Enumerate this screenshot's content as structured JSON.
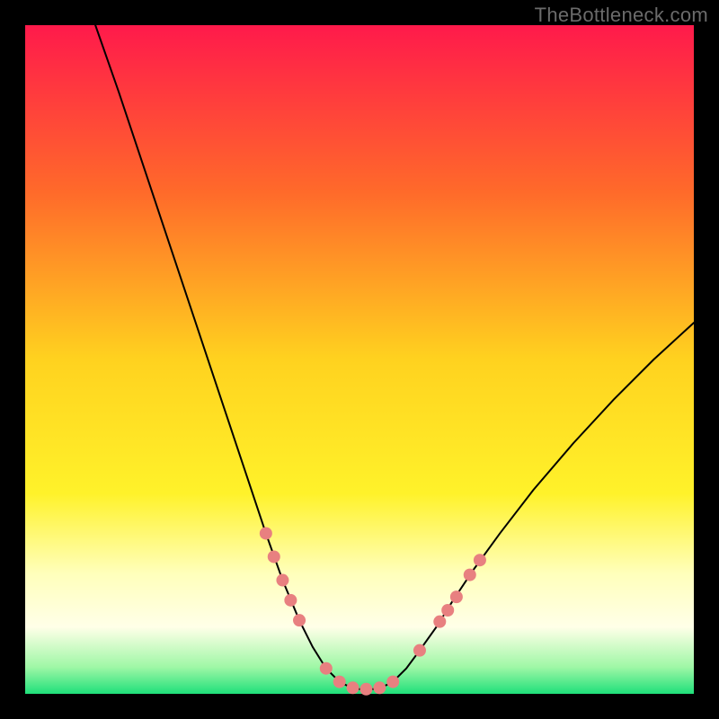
{
  "watermark": "TheBottleneck.com",
  "layout": {
    "outer_w": 800,
    "outer_h": 800,
    "inner_left": 28,
    "inner_top": 28,
    "inner_w": 744,
    "inner_h": 744
  },
  "chart_data": {
    "type": "line",
    "title": "",
    "xlabel": "",
    "ylabel": "",
    "xlim": [
      0,
      100
    ],
    "ylim": [
      0,
      100
    ],
    "grid": false,
    "background_gradient": {
      "stops": [
        {
          "t": 0.0,
          "color": "#ff1a4b"
        },
        {
          "t": 0.25,
          "color": "#ff6a2a"
        },
        {
          "t": 0.5,
          "color": "#ffd21f"
        },
        {
          "t": 0.7,
          "color": "#fff22a"
        },
        {
          "t": 0.82,
          "color": "#ffffbb"
        },
        {
          "t": 0.9,
          "color": "#ffffe8"
        },
        {
          "t": 0.96,
          "color": "#9ff7a6"
        },
        {
          "t": 1.0,
          "color": "#1fe07a"
        }
      ]
    },
    "series": [
      {
        "name": "bottleneck-curve",
        "color": "#000000",
        "width": 2,
        "points_xy": [
          [
            10.5,
            100.0
          ],
          [
            14.0,
            90.0
          ],
          [
            18.0,
            78.0
          ],
          [
            22.0,
            66.0
          ],
          [
            26.0,
            54.0
          ],
          [
            30.0,
            42.0
          ],
          [
            33.0,
            33.0
          ],
          [
            36.0,
            24.0
          ],
          [
            38.5,
            17.0
          ],
          [
            41.0,
            11.0
          ],
          [
            43.0,
            7.0
          ],
          [
            45.0,
            3.8
          ],
          [
            47.0,
            1.8
          ],
          [
            49.0,
            0.8
          ],
          [
            51.0,
            0.6
          ],
          [
            53.0,
            0.8
          ],
          [
            55.0,
            1.8
          ],
          [
            57.0,
            3.8
          ],
          [
            59.0,
            6.5
          ],
          [
            61.5,
            10.0
          ],
          [
            64.0,
            14.0
          ],
          [
            67.0,
            18.5
          ],
          [
            71.0,
            24.0
          ],
          [
            76.0,
            30.5
          ],
          [
            82.0,
            37.5
          ],
          [
            88.0,
            44.0
          ],
          [
            94.0,
            50.0
          ],
          [
            100.0,
            55.5
          ]
        ]
      }
    ],
    "markers": {
      "name": "highlight-dots",
      "color": "#e88080",
      "radius": 7,
      "points_xy": [
        [
          36.0,
          24.0
        ],
        [
          37.2,
          20.5
        ],
        [
          38.5,
          17.0
        ],
        [
          39.7,
          14.0
        ],
        [
          41.0,
          11.0
        ],
        [
          45.0,
          3.8
        ],
        [
          47.0,
          1.8
        ],
        [
          49.0,
          0.9
        ],
        [
          51.0,
          0.7
        ],
        [
          53.0,
          0.9
        ],
        [
          55.0,
          1.8
        ],
        [
          59.0,
          6.5
        ],
        [
          62.0,
          10.8
        ],
        [
          63.2,
          12.5
        ],
        [
          64.5,
          14.5
        ],
        [
          66.5,
          17.8
        ],
        [
          68.0,
          20.0
        ]
      ]
    }
  }
}
